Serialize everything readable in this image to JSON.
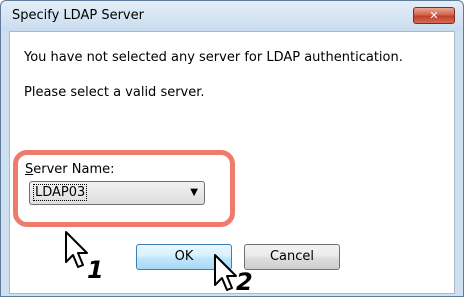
{
  "window": {
    "title": "Specify LDAP Server",
    "close_label": "✕"
  },
  "message": {
    "line1": "You have not selected any server for LDAP authentication.",
    "line2": "Please select a valid server."
  },
  "server_select": {
    "label_accel": "S",
    "label_rest": "erver Name:",
    "value": "LDAP03"
  },
  "buttons": {
    "ok_label": "OK",
    "cancel_label": "Cancel"
  },
  "callouts": {
    "step1": "1",
    "step2": "2"
  },
  "colors": {
    "highlight_border": "#ee7b6c",
    "close_button": "#c2412c",
    "frame": "#cfe0f1"
  }
}
